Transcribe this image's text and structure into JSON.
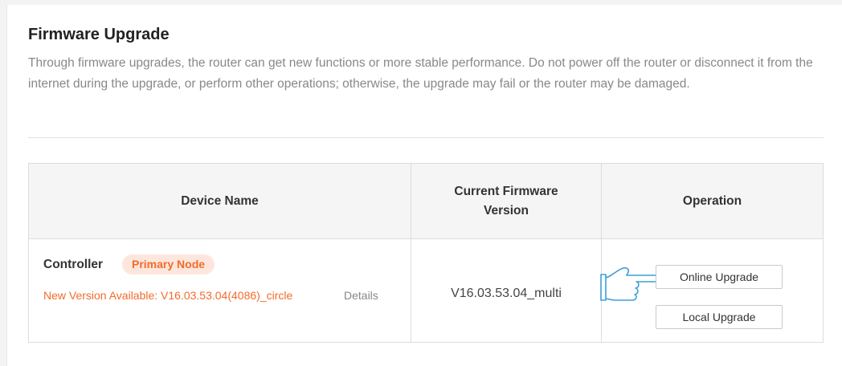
{
  "page": {
    "title": "Firmware Upgrade",
    "description": "Through firmware upgrades, the router can get new functions or more stable performance. Do not power off the router or disconnect it from the internet during the upgrade, or perform other operations; otherwise, the upgrade may fail or the router may be damaged."
  },
  "table": {
    "headers": {
      "device_name": "Device Name",
      "current_firmware": "Current Firmware Version",
      "operation": "Operation"
    },
    "rows": [
      {
        "device_name": "Controller",
        "badge": "Primary Node",
        "new_version": "New Version Available: V16.03.53.04(4086)_circle",
        "details_label": "Details",
        "current_version": "V16.03.53.04_multi",
        "online_upgrade_label": "Online Upgrade",
        "local_upgrade_label": "Local Upgrade"
      }
    ]
  },
  "icons": {
    "pointer": "pointing-hand-icon"
  },
  "colors": {
    "accent": "#f36b2b",
    "badge_bg": "#fde7dd",
    "pointer_stroke": "#3aa0d8"
  }
}
